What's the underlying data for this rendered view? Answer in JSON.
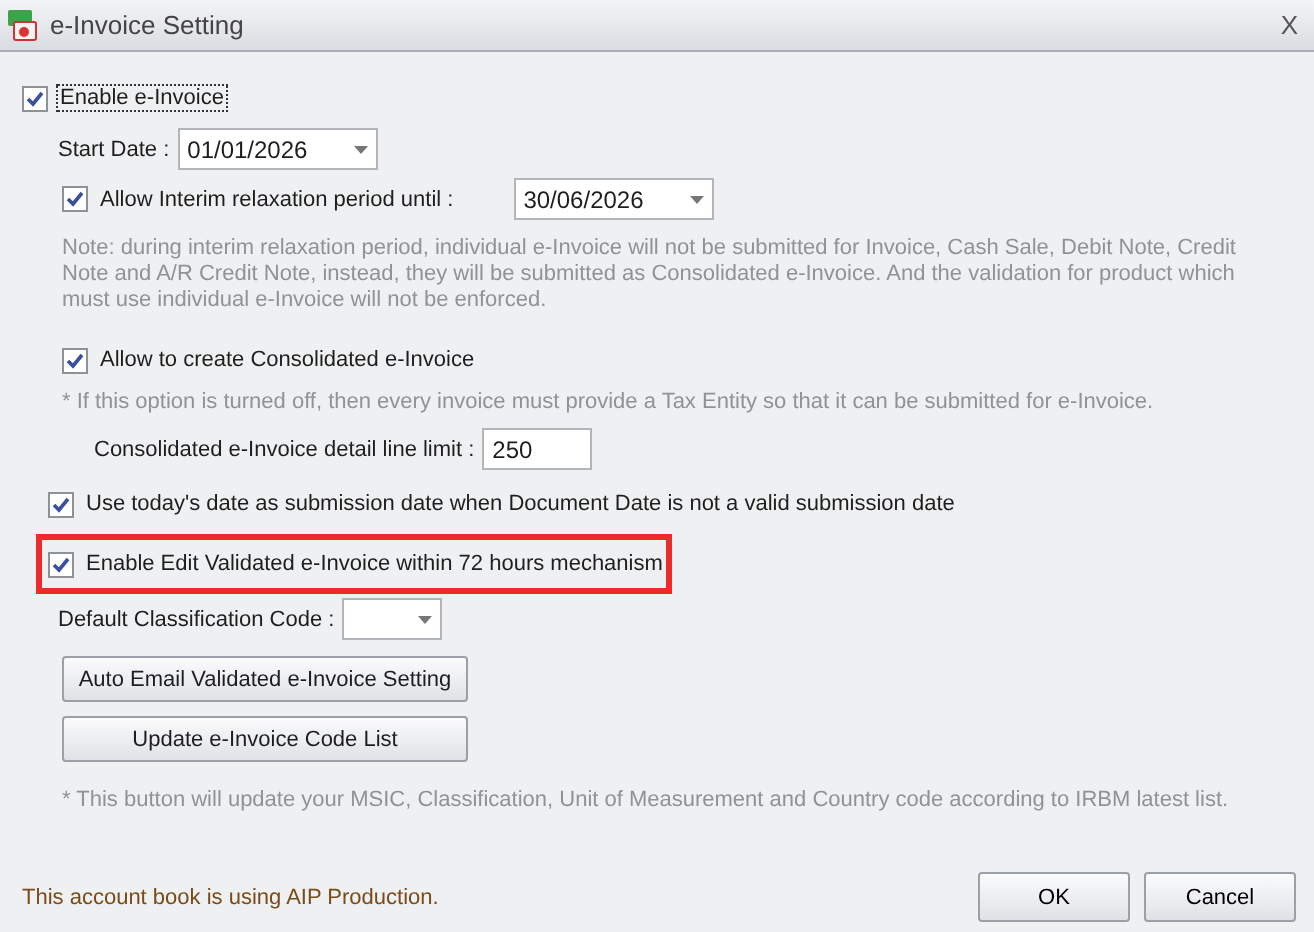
{
  "window": {
    "title": "e-Invoice Setting",
    "close": "X"
  },
  "enable": {
    "label": "Enable e-Invoice",
    "checked": true
  },
  "start_date": {
    "label": "Start Date :",
    "value": "01/01/2026"
  },
  "interim": {
    "label": "Allow Interim relaxation period until :",
    "checked": true,
    "value": "30/06/2026"
  },
  "interim_note": "Note: during interim relaxation period, individual e-Invoice will not be submitted for Invoice, Cash Sale, Debit Note, Credit Note and A/R Credit Note, instead, they will be submitted as Consolidated e-Invoice. And the validation for product which must use individual e-Invoice will not be enforced.",
  "consolidated": {
    "label": "Allow to create Consolidated e-Invoice",
    "checked": true
  },
  "consolidated_note": "* If this option is turned off, then every invoice must provide a Tax Entity so that it can be submitted for e-Invoice.",
  "line_limit": {
    "label": "Consolidated e-Invoice detail line limit :",
    "value": "250"
  },
  "options": [
    {
      "label": "Use today's date as submission date when Document Date is not a valid submission date",
      "checked": true,
      "highlighted": false
    },
    {
      "label": "Enable Edit Validated e-Invoice within 72 hours mechanism",
      "checked": true,
      "highlighted": true
    }
  ],
  "classification": {
    "label": "Default Classification Code :"
  },
  "buttons": [
    "Auto Email Validated e-Invoice Setting",
    "Update e-Invoice Code List"
  ],
  "update_note": "* This button will update your MSIC, Classification, Unit of Measurement and Country code according to IRBM latest list.",
  "footer": {
    "message": "This account book is using AIP Production.",
    "buttons": [
      "OK",
      "Cancel"
    ]
  }
}
